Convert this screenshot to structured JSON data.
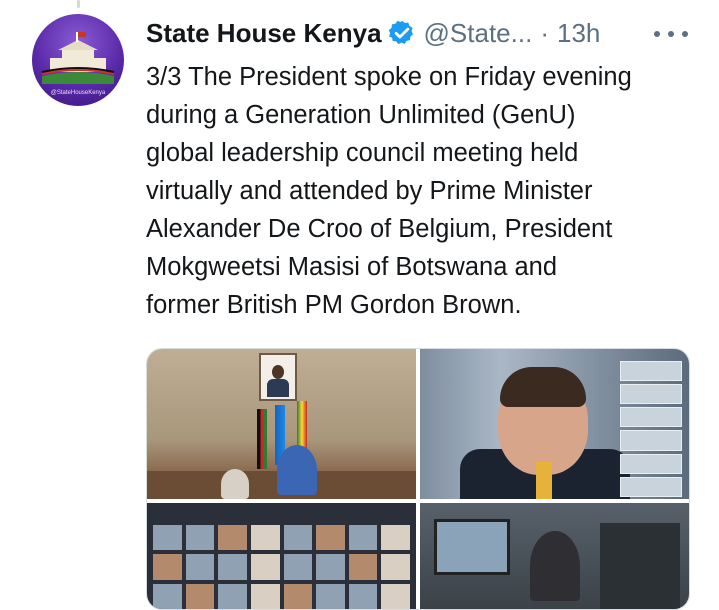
{
  "tweet": {
    "display_name": "State House Kenya",
    "handle": "@State...",
    "separator": "·",
    "timestamp": "13h",
    "verified": true,
    "avatar_caption": "@StateHouseKenya",
    "text_lines": [
      "3/3 The President spoke on Friday evening",
      "during a Generation Unlimited (GenU)",
      "global leadership council meeting held",
      "virtually and attended by Prime Minister",
      "Alexander De Croo of Belgium, President",
      "Mokgweetsi Masisi of Botswana and",
      "former British PM Gordon Brown."
    ]
  },
  "icons": {
    "verified": "verified-badge-icon",
    "more": "more-options-icon"
  },
  "colors": {
    "verified_blue": "#1d9bf0",
    "secondary_text": "#5b7083",
    "primary_text": "#14171a",
    "avatar_purple": "#5a2aa8"
  }
}
